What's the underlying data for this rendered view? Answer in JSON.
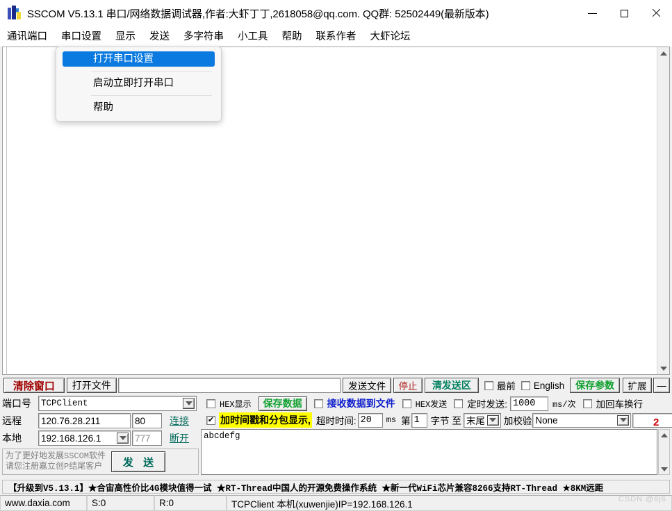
{
  "window": {
    "title": "SSCOM V5.13.1 串口/网络数据调试器,作者:大虾丁丁,2618058@qq.com. QQ群: 52502449(最新版本)",
    "icon": "sscom-app-icon",
    "minimize": "—",
    "maximize": "□",
    "close": "✕"
  },
  "menubar": {
    "items": [
      {
        "label": "通讯端口",
        "name": "menu-comm-port"
      },
      {
        "label": "串口设置",
        "name": "menu-serial-settings"
      },
      {
        "label": "显示",
        "name": "menu-display"
      },
      {
        "label": "发送",
        "name": "menu-send"
      },
      {
        "label": "多字符串",
        "name": "menu-multi-string"
      },
      {
        "label": "小工具",
        "name": "menu-tools"
      },
      {
        "label": "帮助",
        "name": "menu-help"
      },
      {
        "label": "联系作者",
        "name": "menu-contact-author"
      },
      {
        "label": "大虾论坛",
        "name": "menu-forum"
      }
    ]
  },
  "dropdown": {
    "open_for": "串口设置",
    "items": [
      {
        "label": "打开串口设置",
        "selected": true
      },
      {
        "label": "启动立即打开串口",
        "selected": false
      },
      {
        "label": "帮助",
        "selected": false
      }
    ]
  },
  "receive_area": {
    "content": "",
    "scroll_up": "▲",
    "scroll_down": "▼"
  },
  "toolbar": {
    "clear_window": "清除窗口",
    "open_file": "打开文件",
    "file_path": "",
    "send_file": "发送文件",
    "stop": "停止",
    "clear_send_area": "清发送区",
    "topmost_label": "最前",
    "topmost_checked": false,
    "english_label": "English",
    "english_checked": false,
    "save_params": "保存参数",
    "extend": "扩展",
    "dash": "—"
  },
  "left_panel": {
    "port_label": "端口号",
    "port_value": "TCPClient",
    "remote_label": "远程",
    "remote_ip": "120.76.28.211",
    "remote_port": "80",
    "connect_button": "连接",
    "local_label": "本地",
    "local_ip": "192.168.126.1",
    "local_port": "777",
    "disconnect_button": "断开",
    "promo_line1": "为了更好地发展SSCOM软件",
    "promo_line2": "请您注册嘉立创P结尾客户",
    "send_button": "发 送"
  },
  "right_panel": {
    "hex_display_label": "HEX显示",
    "hex_display_checked": false,
    "save_data_button": "保存数据",
    "recv_to_file_label": "接收数据到文件",
    "recv_to_file_checked": false,
    "hex_send_label": "HEX发送",
    "hex_send_checked": false,
    "timed_send_label": "定时发送:",
    "timed_send_checked": false,
    "timed_send_value": "1000",
    "ms_per_time": "ms/次",
    "crlf_label": "加回车换行",
    "crlf_checked": false,
    "timestamp_label": "加时间戳和分包显示,",
    "timestamp_checked": true,
    "timeout_label": "超时时间:",
    "timeout_value": "20",
    "timeout_unit": "ms",
    "byte_prefix": "第",
    "byte_index": "1",
    "byte_word": "字节 至",
    "byte_end": "末尾",
    "checksum_label": "加校验",
    "checksum_value": "None",
    "extra_value": "",
    "send_text": "abcdefg",
    "scroll_up": "▲",
    "scroll_down": "▼"
  },
  "ad_banner": {
    "text": "【升级到V5.13.1】★合宙高性价比4G模块值得一试 ★RT-Thread中国人的开源免费操作系统 ★新一代WiFi芯片兼容8266支持RT-Thread ★8KM远距"
  },
  "statusbar": {
    "website": "www.daxia.com",
    "sent": "S:0",
    "received": "R:0",
    "connection": "TCPClient 本机(xuwenjie)IP=192.168.126.1"
  },
  "watermark": "CSDN @6j6",
  "colors": {
    "accent_blue": "#0a7ae0",
    "clear_red": "#a00000",
    "green_button": "#12a030",
    "teal_link": "#006a5a",
    "highlight_yellow": "#ffff00",
    "stop_red": "#b02020"
  }
}
